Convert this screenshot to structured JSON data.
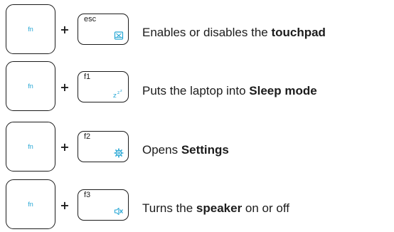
{
  "shortcuts": [
    {
      "modifier": "fn",
      "plus": "+",
      "key": "esc",
      "icon": "touchpad-toggle-icon",
      "desc_before": "Enables or disables the ",
      "desc_bold": "touchpad",
      "desc_after": ""
    },
    {
      "modifier": "fn",
      "plus": "+",
      "key": "f1",
      "icon": "sleep-icon",
      "desc_before": "Puts the laptop into ",
      "desc_bold": "Sleep mode",
      "desc_after": ""
    },
    {
      "modifier": "fn",
      "plus": "+",
      "key": "f2",
      "icon": "settings-gear-icon",
      "desc_before": "Opens ",
      "desc_bold": "Settings",
      "desc_after": ""
    },
    {
      "modifier": "fn",
      "plus": "+",
      "key": "f3",
      "icon": "speaker-mute-icon",
      "desc_before": "Turns the ",
      "desc_bold": "speaker",
      "desc_after": " on or off"
    }
  ],
  "colors": {
    "accent": "#25a6d4",
    "text": "#1c1c1c",
    "background": "#ffffff"
  }
}
